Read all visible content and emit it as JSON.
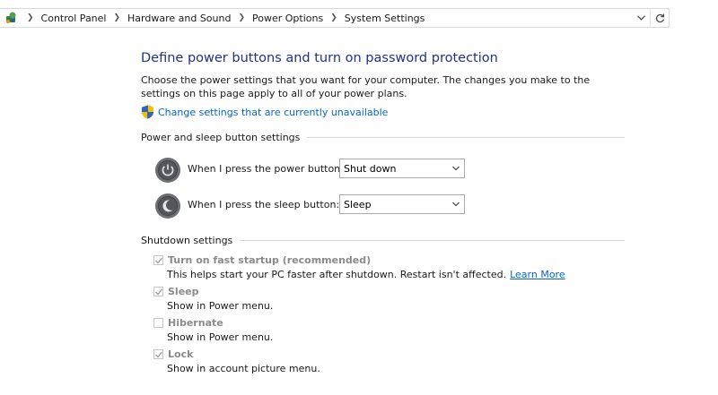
{
  "address_bar": {
    "icon": "control-panel-icon",
    "crumbs": [
      "Control Panel",
      "Hardware and Sound",
      "Power Options",
      "System Settings"
    ],
    "dropdown_icon": "chevron-down-icon",
    "refresh_icon": "refresh-icon"
  },
  "page": {
    "title": "Define power buttons and turn on password protection",
    "description": "Choose the power settings that you want for your computer. The changes you make to the settings on this page apply to all of your power plans.",
    "change_settings_link": "Change settings that are currently unavailable",
    "shield_icon": "uac-shield-icon"
  },
  "power_sleep_group": {
    "label": "Power and sleep button settings",
    "power_button": {
      "label": "When I press the power button:",
      "value": "Shut down",
      "icon": "power-button-icon"
    },
    "sleep_button": {
      "label": "When I press the sleep button:",
      "value": "Sleep",
      "icon": "sleep-button-icon"
    }
  },
  "shutdown_group": {
    "label": "Shutdown settings",
    "options": [
      {
        "label": "Turn on fast startup (recommended)",
        "checked": true,
        "desc": "This helps start your PC faster after shutdown. Restart isn't affected.",
        "link": "Learn More"
      },
      {
        "label": "Sleep",
        "checked": true,
        "desc": "Show in Power menu."
      },
      {
        "label": "Hibernate",
        "checked": false,
        "desc": "Show in Power menu."
      },
      {
        "label": "Lock",
        "checked": true,
        "desc": "Show in account picture menu."
      }
    ]
  },
  "colors": {
    "heading": "#1e3287",
    "link": "#0066cc",
    "disabled_text": "#8a8a8a"
  }
}
